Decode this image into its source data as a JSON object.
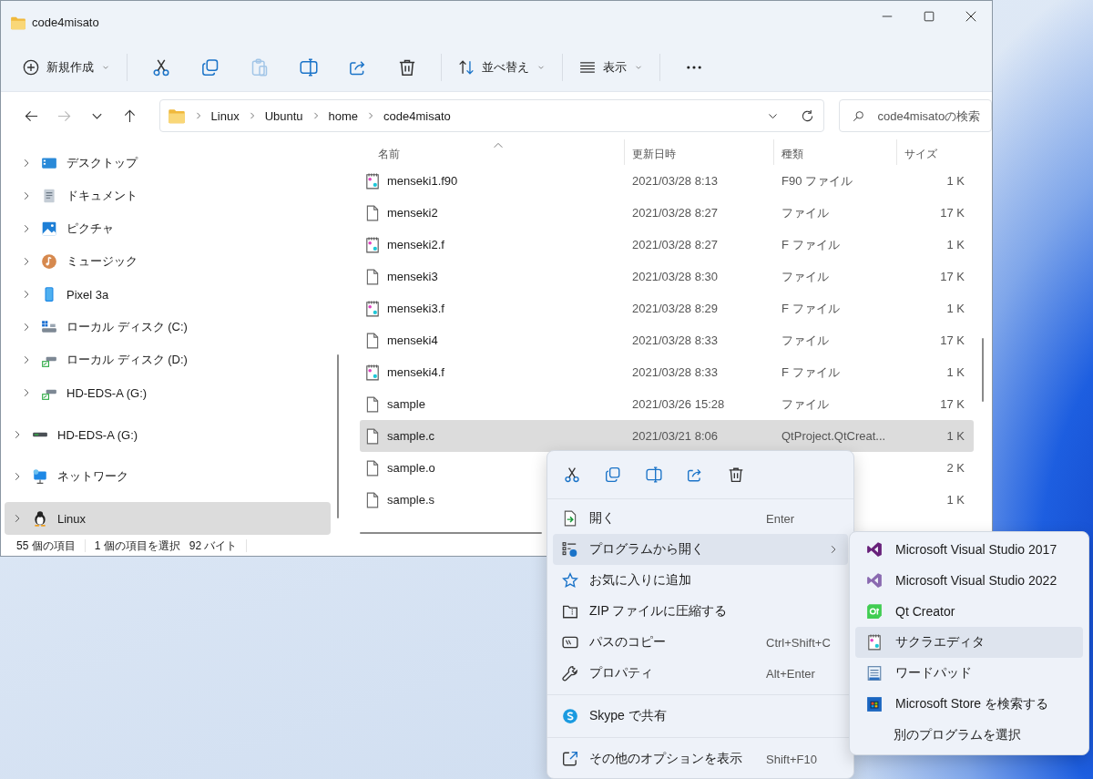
{
  "window": {
    "title": "code4misato"
  },
  "toolbar": {
    "new_button": {
      "label": "新規作成"
    },
    "actions": [
      {
        "kind": "cut",
        "disabled": false
      },
      {
        "kind": "copy",
        "disabled": false
      },
      {
        "kind": "paste",
        "disabled": true
      },
      {
        "kind": "rename",
        "disabled": false
      },
      {
        "kind": "share",
        "disabled": false
      },
      {
        "kind": "delete",
        "disabled": false
      }
    ],
    "sort_button": {
      "label": "並べ替え"
    },
    "view_button": {
      "label": "表示"
    }
  },
  "navigation": {
    "back": {
      "disabled": false
    },
    "forward": {
      "disabled": true
    }
  },
  "address_bar": {
    "path": [
      "Linux",
      "Ubuntu",
      "home",
      "code4misato"
    ]
  },
  "search": {
    "placeholder": "code4misatoの検索"
  },
  "nav_pane": {
    "nested_items": [
      {
        "kind": "desktop",
        "label": "デスクトップ",
        "selected": false
      },
      {
        "kind": "documents",
        "label": "ドキュメント",
        "selected": false
      },
      {
        "kind": "pictures",
        "label": "ピクチャ",
        "selected": false
      },
      {
        "kind": "music",
        "label": "ミュージック",
        "selected": false
      },
      {
        "kind": "phone",
        "label": "Pixel 3a",
        "selected": false
      },
      {
        "kind": "drive_c",
        "label": "ローカル ディスク (C:)",
        "selected": false
      },
      {
        "kind": "drive_net",
        "label": "ローカル ディスク (D:)",
        "selected": false
      },
      {
        "kind": "drive_net",
        "label": "HD-EDS-A (G:)",
        "selected": false
      }
    ],
    "items": [
      {
        "kind": "drive",
        "label": "HD-EDS-A (G:)",
        "selected": false
      },
      {
        "kind": "network",
        "label": "ネットワーク",
        "selected": false
      },
      {
        "kind": "linux",
        "label": "Linux",
        "selected": true
      }
    ]
  },
  "file_list": {
    "columns": [
      {
        "label": "名前",
        "sorted": true
      },
      {
        "label": "更新日時",
        "sorted": false
      },
      {
        "label": "種類",
        "sorted": false
      },
      {
        "label": "サイズ",
        "sorted": false
      }
    ],
    "rows": [
      {
        "kind": "notepad",
        "name": "menseki1.f90",
        "modified": "2021/03/28 8:13",
        "type": "F90 ファイル",
        "size": "1 K",
        "selected": false
      },
      {
        "kind": "blank",
        "name": "menseki2",
        "modified": "2021/03/28 8:27",
        "type": "ファイル",
        "size": "17 K",
        "selected": false
      },
      {
        "kind": "notepad",
        "name": "menseki2.f",
        "modified": "2021/03/28 8:27",
        "type": "F ファイル",
        "size": "1 K",
        "selected": false
      },
      {
        "kind": "blank",
        "name": "menseki3",
        "modified": "2021/03/28 8:30",
        "type": "ファイル",
        "size": "17 K",
        "selected": false
      },
      {
        "kind": "notepad",
        "name": "menseki3.f",
        "modified": "2021/03/28 8:29",
        "type": "F ファイル",
        "size": "1 K",
        "selected": false
      },
      {
        "kind": "blank",
        "name": "menseki4",
        "modified": "2021/03/28 8:33",
        "type": "ファイル",
        "size": "17 K",
        "selected": false
      },
      {
        "kind": "notepad",
        "name": "menseki4.f",
        "modified": "2021/03/28 8:33",
        "type": "F ファイル",
        "size": "1 K",
        "selected": false
      },
      {
        "kind": "blank",
        "name": "sample",
        "modified": "2021/03/26 15:28",
        "type": "ファイル",
        "size": "17 K",
        "selected": false
      },
      {
        "kind": "blank",
        "name": "sample.c",
        "modified": "2021/03/21 8:06",
        "type": "QtProject.QtCreat...",
        "size": "1 K",
        "selected": true
      },
      {
        "kind": "blank",
        "name": "sample.o",
        "size": "2 K",
        "selected": false
      },
      {
        "kind": "blank",
        "name": "sample.s",
        "size": "1 K",
        "selected": false
      }
    ]
  },
  "status_bar": {
    "item_count": "55 個の項目",
    "selection": "1 個の項目を選択",
    "selection_size": "92 バイト"
  },
  "context_menu": {
    "quick_actions": [
      {
        "kind": "cut"
      },
      {
        "kind": "copy"
      },
      {
        "kind": "rename"
      },
      {
        "kind": "share"
      },
      {
        "kind": "delete"
      }
    ],
    "items": [
      {
        "kind": "open",
        "label": "開く",
        "shortcut": "Enter",
        "selected": false,
        "submenu": false
      },
      {
        "kind": "openwith",
        "label": "プログラムから開く",
        "selected": true,
        "submenu": true
      },
      {
        "kind": "star",
        "label": "お気に入りに追加",
        "selected": false,
        "submenu": false
      },
      {
        "kind": "zip",
        "label": "ZIP ファイルに圧縮する",
        "selected": false,
        "submenu": false
      },
      {
        "kind": "path",
        "label": "パスのコピー",
        "shortcut": "Ctrl+Shift+C",
        "selected": false,
        "submenu": false
      },
      {
        "kind": "wrench",
        "label": "プロパティ",
        "shortcut": "Alt+Enter",
        "selected": false,
        "submenu": false
      },
      {
        "kind": "separator"
      },
      {
        "kind": "skype",
        "label": "Skype で共有",
        "selected": false,
        "submenu": false
      },
      {
        "kind": "separator"
      },
      {
        "kind": "moreopts",
        "label": "その他のオプションを表示",
        "shortcut": "Shift+F10",
        "selected": false,
        "submenu": false
      }
    ]
  },
  "submenu": {
    "items": [
      {
        "kind": "vs2017",
        "label": "Microsoft Visual Studio 2017",
        "selected": false
      },
      {
        "kind": "vs2022",
        "label": "Microsoft Visual Studio 2022",
        "selected": false
      },
      {
        "kind": "qt",
        "label": "Qt Creator",
        "selected": false
      },
      {
        "kind": "sakura",
        "label": "サクラエディタ",
        "selected": true
      },
      {
        "kind": "wordpad",
        "label": "ワードパッド",
        "selected": false
      },
      {
        "kind": "store",
        "label": "Microsoft Store を検索する",
        "selected": false
      },
      {
        "kind": "other",
        "label": "別のプログラムを選択",
        "selected": false
      }
    ]
  }
}
